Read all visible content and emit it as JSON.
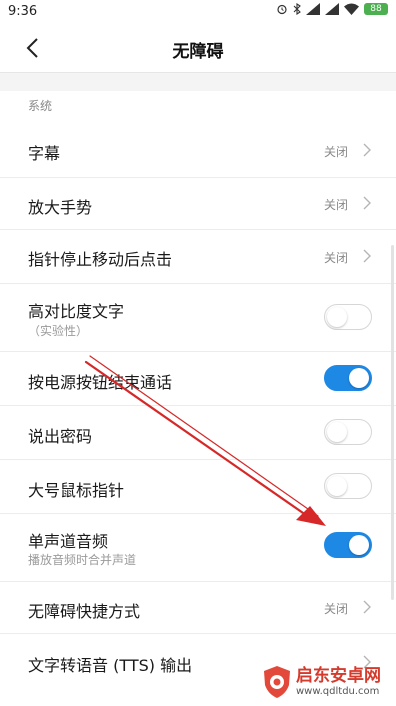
{
  "status_bar": {
    "time": "9:36",
    "battery": "88",
    "icons": [
      "alarm-icon",
      "bluetooth-icon",
      "signal-icon",
      "signal-icon",
      "wifi-icon",
      "battery-icon"
    ]
  },
  "header": {
    "title": "无障碍",
    "back_icon": "chevron-left-icon"
  },
  "section": {
    "label": "系统"
  },
  "rows": {
    "captions": {
      "title": "字幕",
      "value": "关闭"
    },
    "magnification": {
      "title": "放大手势",
      "value": "关闭"
    },
    "dwell_click": {
      "title": "指针停止移动后点击",
      "value": "关闭"
    },
    "high_contrast": {
      "title": "高对比度文字",
      "subtitle": "（实验性）",
      "enabled": false
    },
    "power_ends_call": {
      "title": "按电源按钮结束通话",
      "enabled": true
    },
    "speak_passwords": {
      "title": "说出密码",
      "enabled": false
    },
    "large_pointer": {
      "title": "大号鼠标指针",
      "enabled": false
    },
    "mono_audio": {
      "title": "单声道音频",
      "subtitle": "播放音频时合并声道",
      "enabled": true
    },
    "shortcut": {
      "title": "无障碍快捷方式",
      "value": "关闭"
    },
    "tts": {
      "title": "文字转语音 (TTS) 输出"
    }
  },
  "colors": {
    "toggle_on": "#1e88e5",
    "annotation_arrow": "#d62828",
    "watermark": "#d53a2c"
  },
  "watermark": {
    "name": "启东安卓网",
    "url": "www.qdltdu.com"
  }
}
